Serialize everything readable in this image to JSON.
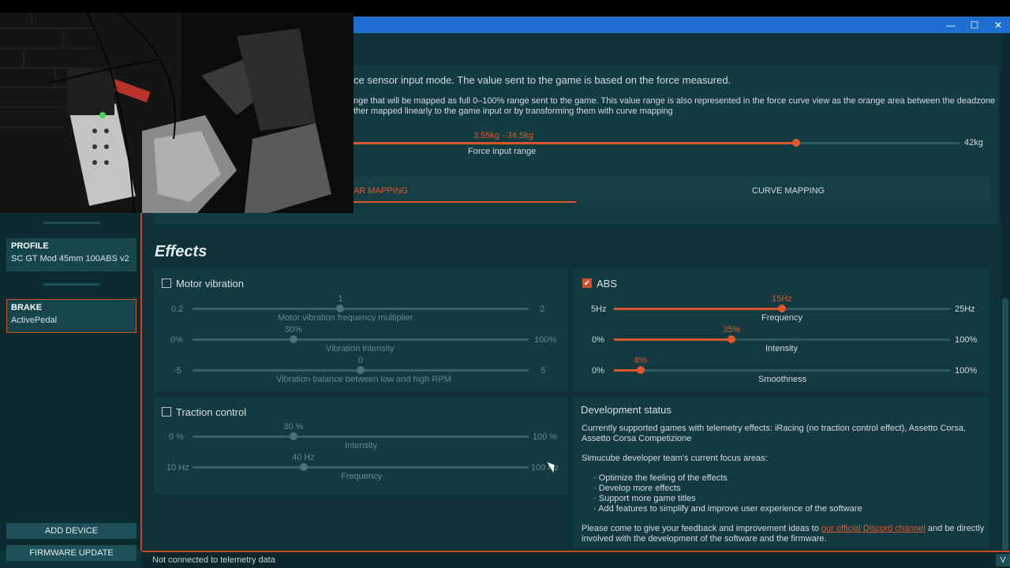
{
  "window": {
    "minimize": "—",
    "maximize": "☐",
    "close": "✕"
  },
  "sidebar": {
    "profile_title": "PROFILE",
    "profile_value": "SC GT Mod 45mm 100ABS v2 ...",
    "brake_title": "BRAKE",
    "brake_value": "ActivePedal",
    "add_device": "ADD DEVICE",
    "firmware_update": "FIRMWARE UPDATE"
  },
  "sensor": {
    "lead_text": "ce sensor input mode. The value sent to the game is based on the force measured.",
    "desc_line1": "nge that will be mapped as full 0–100% range sent to the game. This value range is also represented in the force curve view as the orange area between the deadzone",
    "desc_line2": "ther mapped linearly to the game input or by transforming them with curve mapping",
    "range_value": "3.55kg - 34.5kg",
    "range_label": "Force input range",
    "range_max": "42kg",
    "range_fraction": 0.73
  },
  "tabs": {
    "linear": "AR MAPPING",
    "curve": "CURVE MAPPING"
  },
  "effects": {
    "title": "Effects",
    "motor": {
      "label": "Motor vibration",
      "freq": {
        "value": "1",
        "min": "0.2",
        "max": "2",
        "label": "Motor vibration frequency multiplier",
        "fraction": 0.44
      },
      "intensity": {
        "value": "30%",
        "min": "0%",
        "max": "100%",
        "label": "Vibration intensity",
        "fraction": 0.3
      },
      "balance": {
        "value": "0",
        "min": "-5",
        "max": "5",
        "label": "Vibration balance between low and high RPM",
        "fraction": 0.5
      }
    },
    "abs": {
      "label": "ABS",
      "check": "✔",
      "freq": {
        "value": "15Hz",
        "min": "5Hz",
        "max": "25Hz",
        "label": "Frequency",
        "fraction": 0.5
      },
      "intensity": {
        "value": "35%",
        "min": "0%",
        "max": "100%",
        "label": "Intensity",
        "fraction": 0.35
      },
      "smoothness": {
        "value": "8%",
        "min": "0%",
        "max": "100%",
        "label": "Smoothness",
        "fraction": 0.08
      }
    },
    "traction": {
      "label": "Traction control",
      "intensity": {
        "value": "30 %",
        "min": "0 %",
        "max": "100 %",
        "label": "Intensity",
        "fraction": 0.3
      },
      "freq": {
        "value": "40 Hz",
        "min": "10 Hz",
        "max": "100 Hz",
        "label": "Frequency",
        "fraction": 0.33
      }
    }
  },
  "dev": {
    "title": "Development status",
    "p1a": "Currently supported games with telemetry effects: iRacing (no traction control effect), Assetto Corsa,",
    "p1b": "Assetto Corsa Competizione",
    "p2": "Simucube developer team's current focus areas:",
    "bullets": [
      "Optimize the feeling of the effects",
      "Develop more effects",
      "Support more game titles",
      "Add features to simplify and improve user experience of the software"
    ],
    "p3a": "Please come to give your feedback and improvement ideas to ",
    "link": "our official Discord channel",
    "p3b": " and be directly",
    "p3c": "involved with the development of the software and the firmware."
  },
  "status": {
    "text": "Not connected to telemetry data",
    "v": "V"
  },
  "colors": {
    "accent": "#e0582a",
    "titlebar": "#1e6fd0",
    "background": "#0e3238"
  }
}
